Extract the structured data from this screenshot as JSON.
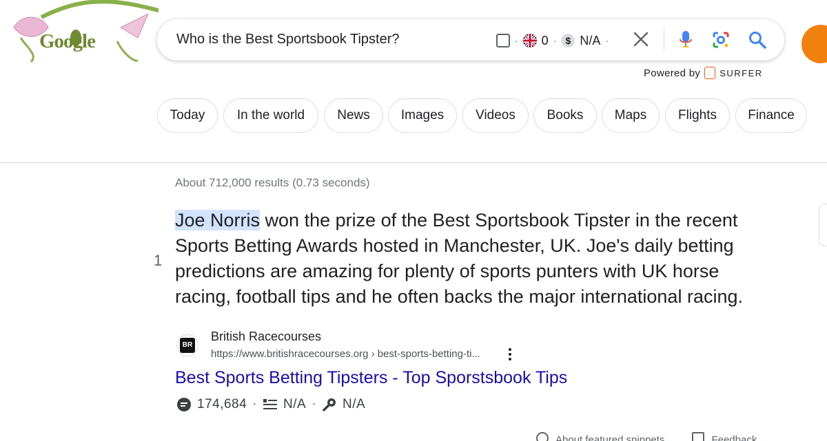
{
  "logo": {
    "text": "Google"
  },
  "search": {
    "query": "Who is the Best Sportsbook Tipster?"
  },
  "extension": {
    "count": "0",
    "na_label": "N/A",
    "powered_prefix": "Powered by",
    "powered_brand": "SURFER"
  },
  "chips": [
    "Today",
    "In the world",
    "News",
    "Images",
    "Videos",
    "Books",
    "Maps",
    "Flights",
    "Finance"
  ],
  "results": {
    "stats": "About 712,000 results (0.73 seconds)"
  },
  "snippet": {
    "highlight": "Joe Norris",
    "text": " won the prize of the Best Sportsbook Tipster in the recent Sports Betting Awards hosted in Manchester, UK. Joe's daily betting predictions are amazing for plenty of sports punters with UK horse racing, football tips and he often backs the major international racing.",
    "number": "1"
  },
  "source": {
    "favicon": "BR",
    "name": "British Racecourses",
    "url": "https://www.britishracecourses.org › best-sports-betting-ti...",
    "title": "Best Sports Betting Tipsters - Top Sporstsbook Tips"
  },
  "metrics": {
    "count": "174,684",
    "na1": "N/A",
    "na2": "N/A"
  },
  "footer": {
    "about": "About featured snippets",
    "feedback": "Feedback"
  },
  "colors": {
    "link": "#1a0dab",
    "highlight": "#d2e3fc",
    "accent_orange": "#f0810f"
  }
}
